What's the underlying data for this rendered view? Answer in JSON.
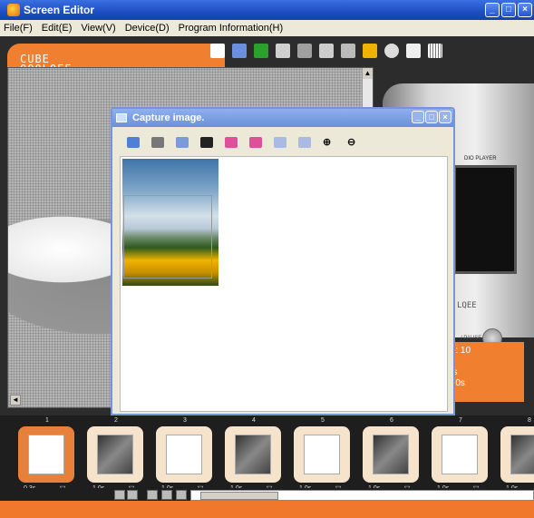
{
  "window": {
    "title": "Screen Editor",
    "controls": [
      "_",
      "□",
      "×"
    ]
  },
  "menu": [
    "File(F)",
    "Edit(E)",
    "View(V)",
    "Device(D)",
    "Program Information(H)"
  ],
  "logo": {
    "line1": "CUBE",
    "line2": "QOOLQEE"
  },
  "main_toolbar": [
    "new-file-icon",
    "open-folder-icon",
    "save-icon",
    "capture-icon",
    "camera-icon",
    "zoom-in-icon",
    "zoom-out-icon",
    "export-icon",
    "settings-icon",
    "transfer-icon",
    "grid-icon"
  ],
  "device": {
    "player_label": "DIO PLAYER",
    "brand": "LQEE",
    "pause_label": "/ PAUSE"
  },
  "info_box": {
    "line1": "e : 10",
    "line2": "0",
    "line3": "0s",
    "line4": "3.0s"
  },
  "capture_dialog": {
    "title": "Capture image.",
    "controls": [
      "_",
      "□",
      "×"
    ],
    "toolbar": [
      "open-folder-icon",
      "camera-icon",
      "monitor-icon",
      "image-icon",
      "undo-icon",
      "redo-icon",
      "prev-icon",
      "next-icon",
      "zoom-in-icon",
      "zoom-out-icon"
    ]
  },
  "timeline": {
    "frames": [
      {
        "num": "1",
        "dur": "0.3s",
        "selected": true,
        "dark": false
      },
      {
        "num": "2",
        "dur": "1.0s",
        "selected": false,
        "dark": true
      },
      {
        "num": "3",
        "dur": "1.0s",
        "selected": false,
        "dark": false
      },
      {
        "num": "4",
        "dur": "1.0s",
        "selected": false,
        "dark": true
      },
      {
        "num": "5",
        "dur": "1.0s",
        "selected": false,
        "dark": false
      },
      {
        "num": "6",
        "dur": "1.0s",
        "selected": false,
        "dark": true
      },
      {
        "num": "7",
        "dur": "1.0s",
        "selected": false,
        "dark": false
      },
      {
        "num": "8",
        "dur": "1.0s",
        "selected": false,
        "dark": true
      }
    ],
    "arrow": "▽"
  },
  "colors": {
    "accent": "#f08030",
    "titlebar": "#1c4fc4",
    "dialog_title": "#7596d6"
  }
}
